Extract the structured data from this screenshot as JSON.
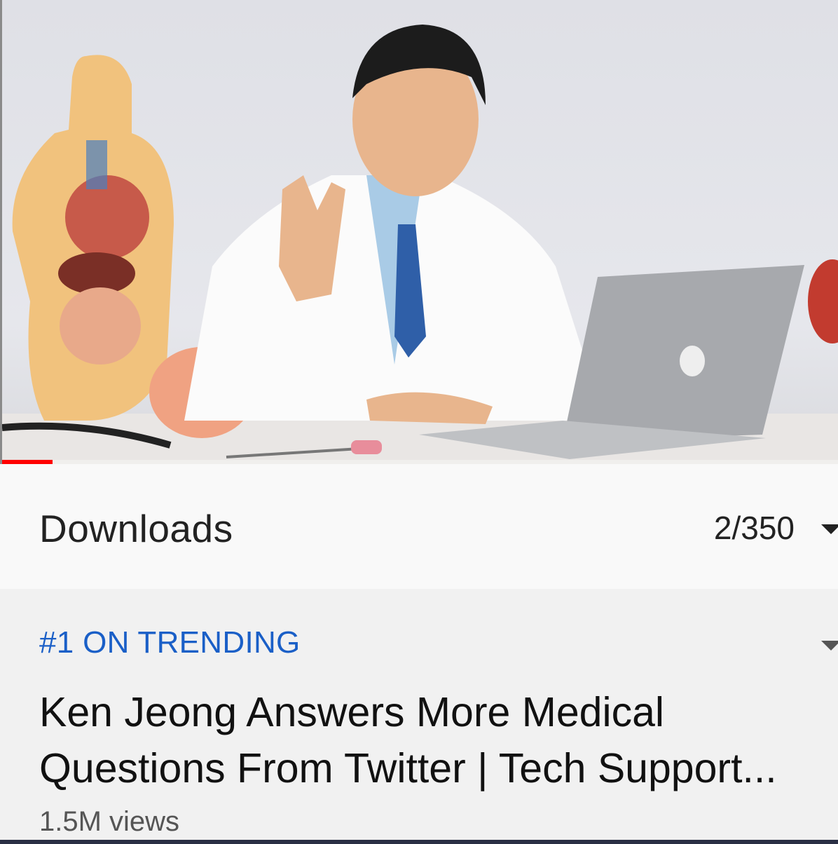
{
  "player": {
    "progress_fraction": 0.06
  },
  "playlist": {
    "title": "Downloads",
    "position": "2/350"
  },
  "video": {
    "badge": "#1 ON TRENDING",
    "title_line1": "Ken Jeong Answers More Medical",
    "title_line2": "Questions From Twitter | Tech Support...",
    "views": "1.5M views"
  },
  "colors": {
    "accent_blue": "#1a5fc7",
    "progress_red": "#ff0000"
  },
  "icons": {
    "playlist_expand": "chevron-down-icon",
    "details_expand": "chevron-down-icon"
  }
}
